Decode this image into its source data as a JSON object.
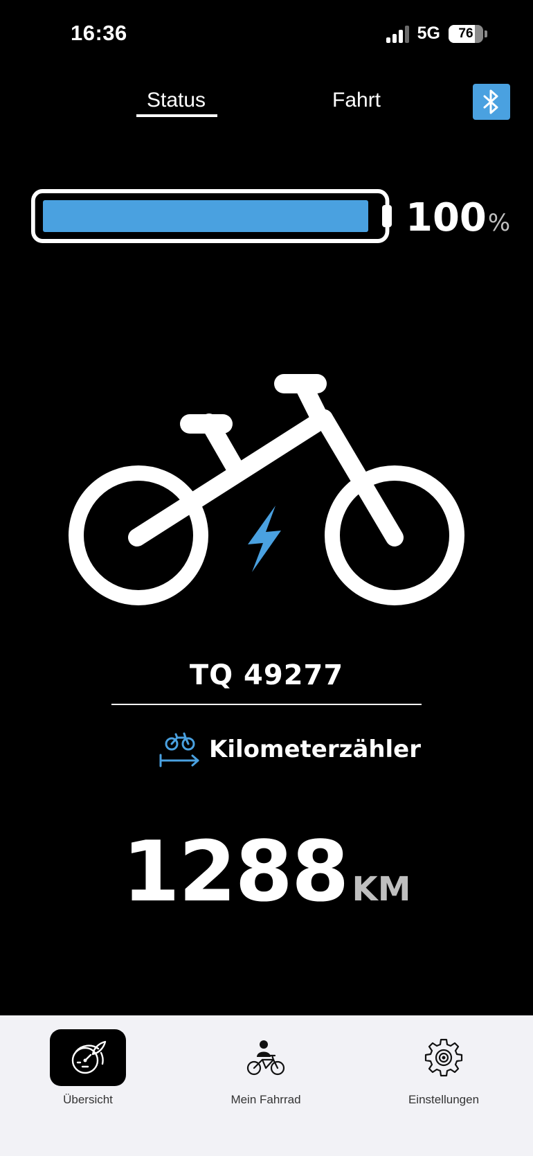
{
  "status_bar": {
    "time": "16:36",
    "network": "5G",
    "battery_level": "76",
    "battery_fraction": 0.76
  },
  "tabs": [
    {
      "label": "Status",
      "active": true
    },
    {
      "label": "Fahrt",
      "active": false
    }
  ],
  "bluetooth": {
    "icon": "bluetooth-icon",
    "color": "#4aa1e0"
  },
  "bike_battery": {
    "value": "100",
    "unit": "%",
    "fraction": 1.0,
    "fill_color": "#4aa1e0"
  },
  "bike": {
    "name": "TQ 49277",
    "icon": "e-bike-icon",
    "bolt_color": "#4aa1e0"
  },
  "odometer": {
    "label": "Kilometerzähler",
    "icon": "odometer-bike-icon",
    "value": "1288",
    "unit": "KM"
  },
  "bottom_nav": {
    "items": [
      {
        "label": "Übersicht",
        "icon": "speedometer-icon",
        "active": true
      },
      {
        "label": "Mein Fahrrad",
        "icon": "rider-bike-icon",
        "active": false
      },
      {
        "label": "Einstellungen",
        "icon": "gear-icon",
        "active": false
      }
    ]
  }
}
